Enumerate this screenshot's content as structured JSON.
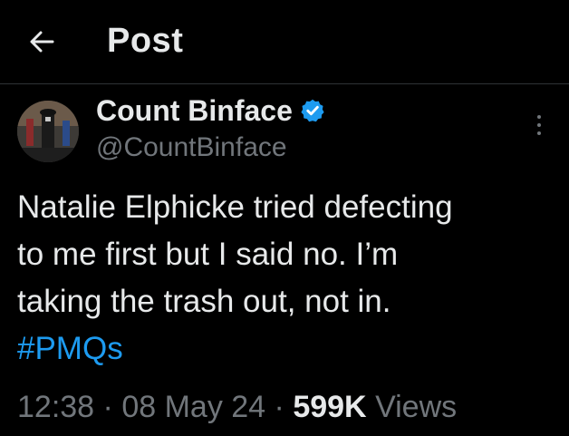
{
  "header": {
    "title": "Post"
  },
  "author": {
    "display_name": "Count Binface",
    "handle": "@CountBinface",
    "verified": true,
    "verified_color": "#1d9bf0"
  },
  "post": {
    "lines": [
      "Natalie Elphicke tried defecting",
      "to me first but I said no. I’m",
      "taking the trash out, not in."
    ],
    "hashtag": "#PMQs"
  },
  "meta": {
    "time": "12:38",
    "separator": "·",
    "date": "08 May 24",
    "views_count": "599K",
    "views_label": "Views"
  },
  "colors": {
    "background": "#000000",
    "text": "#e7e9ea",
    "secondary": "#71767b",
    "accent": "#1d9bf0"
  },
  "icons": {
    "back": "arrow-left-icon",
    "verified": "verified-badge-icon",
    "more": "more-vertical-icon"
  }
}
